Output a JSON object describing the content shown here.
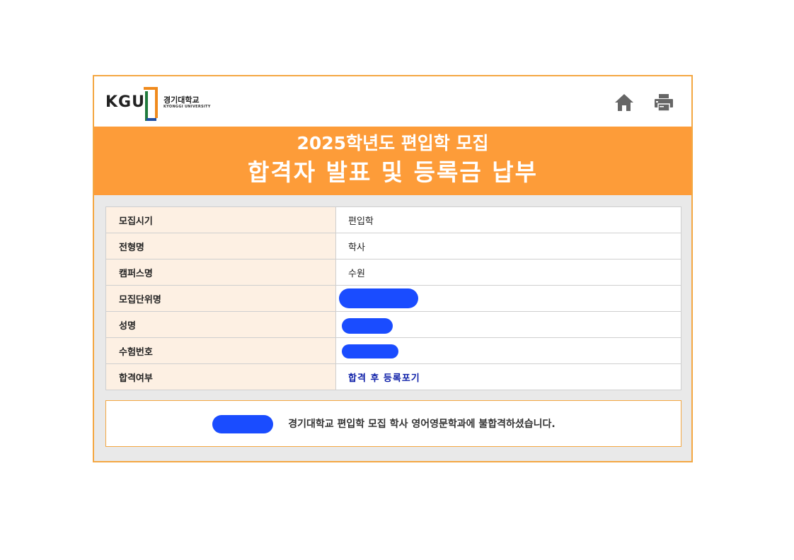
{
  "header": {
    "logo_mark": "KGU",
    "logo_name_ko": "경기대학교",
    "logo_name_en": "KYONGGI UNIVERSITY",
    "icons": [
      "home-icon",
      "print-icon"
    ]
  },
  "banner": {
    "subtitle": "2025학년도 편입학 모집",
    "title": "합격자 발표 및 등록금 납부"
  },
  "info_table": {
    "rows": [
      {
        "label": "모집시기",
        "value": "편입학"
      },
      {
        "label": "전형명",
        "value": "학사"
      },
      {
        "label": "캠퍼스명",
        "value": "수원"
      },
      {
        "label": "모집단위명",
        "value": ""
      },
      {
        "label": "성명",
        "value": ""
      },
      {
        "label": "수험번호",
        "value": ""
      },
      {
        "label": "합격여부",
        "value": "합격 후 등록포기"
      }
    ]
  },
  "message": {
    "text": "경기대학교 편입학 모집 학사 영어영문학과에 불합격하셨습니다."
  },
  "colors": {
    "accent_orange": "#fd9c39",
    "border_orange": "#f4a742",
    "label_bg": "#fdf0e3",
    "result_link": "#0c1ea8",
    "redaction": "#1a4cff"
  }
}
